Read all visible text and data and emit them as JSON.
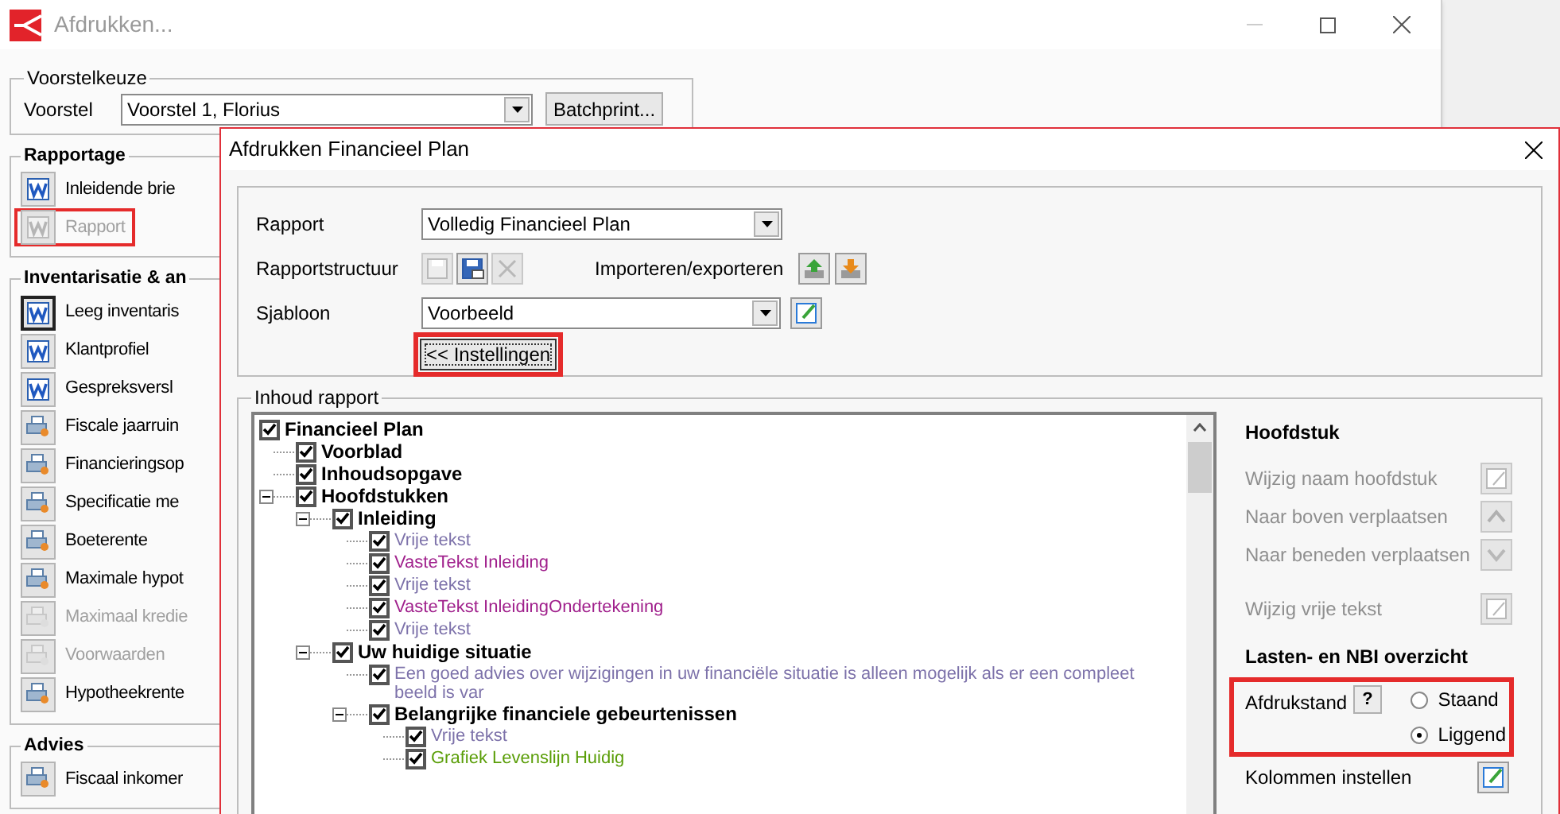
{
  "back_window": {
    "title": "Afdrukken...",
    "voorstelkeuze": {
      "title": "Voorstelkeuze",
      "label": "Voorstel",
      "value": "Voorstel 1, Florius",
      "button": "Batchprint..."
    },
    "groups": [
      {
        "title": "Rapportage",
        "items": [
          {
            "label": "Inleidende brie",
            "kind": "word",
            "disabled": false,
            "focused": false,
            "highlighted": false
          },
          {
            "label": "Rapport",
            "kind": "word",
            "disabled": true,
            "focused": false,
            "highlighted": true
          }
        ]
      },
      {
        "title": "Inventarisatie & an",
        "items": [
          {
            "label": "Leeg inventaris",
            "kind": "word",
            "disabled": false,
            "focused": true,
            "highlighted": false
          },
          {
            "label": "Klantprofiel",
            "kind": "word",
            "disabled": false,
            "focused": false,
            "highlighted": false
          },
          {
            "label": "Gespreksversl",
            "kind": "word",
            "disabled": false,
            "focused": false,
            "highlighted": false
          },
          {
            "label": "Fiscale jaarruin",
            "kind": "report",
            "disabled": false,
            "focused": false,
            "highlighted": false
          },
          {
            "label": "Financieringsop",
            "kind": "report",
            "disabled": false,
            "focused": false,
            "highlighted": false
          },
          {
            "label": "Specificatie me",
            "kind": "report",
            "disabled": false,
            "focused": false,
            "highlighted": false
          },
          {
            "label": "Boeterente",
            "kind": "report",
            "disabled": false,
            "focused": false,
            "highlighted": false
          },
          {
            "label": "Maximale hypot",
            "kind": "report",
            "disabled": false,
            "focused": false,
            "highlighted": false
          },
          {
            "label": "Maximaal kredie",
            "kind": "report",
            "disabled": true,
            "focused": false,
            "highlighted": false
          },
          {
            "label": "Voorwaarden",
            "kind": "report",
            "disabled": true,
            "focused": false,
            "highlighted": false
          },
          {
            "label": "Hypotheekrente",
            "kind": "report",
            "disabled": false,
            "focused": false,
            "highlighted": false
          }
        ]
      },
      {
        "title": "Advies",
        "items": [
          {
            "label": "Fiscaal inkomer",
            "kind": "report",
            "disabled": false,
            "focused": false,
            "highlighted": false
          }
        ]
      }
    ]
  },
  "dialog": {
    "title": "Afdrukken Financieel Plan",
    "rapport": {
      "label": "Rapport",
      "value": "Volledig Financieel Plan"
    },
    "structuur": {
      "label": "Rapportstructuur",
      "icons": [
        {
          "kind": "save",
          "disabled": true
        },
        {
          "kind": "save-as",
          "disabled": false
        },
        {
          "kind": "delete",
          "disabled": true
        }
      ]
    },
    "import_export": {
      "label": "Importeren/exporteren",
      "icons": [
        {
          "kind": "import"
        },
        {
          "kind": "export"
        }
      ]
    },
    "sjabloon": {
      "label": "Sjabloon",
      "value": "Voorbeeld"
    },
    "settings_button": {
      "label": "<< Instellingen",
      "highlighted": true
    },
    "content": {
      "title": "Inhoud rapport",
      "tree": [
        {
          "label": "Financieel Plan",
          "kind": "heading",
          "checked": true,
          "children": [
            {
              "label": "Voorblad",
              "kind": "heading",
              "checked": true
            },
            {
              "label": "Inhoudsopgave",
              "kind": "heading",
              "checked": true
            },
            {
              "label": "Hoofdstukken",
              "kind": "heading",
              "checked": true,
              "expanded": true,
              "children": [
                {
                  "label": "Inleiding",
                  "kind": "heading",
                  "checked": true,
                  "expanded": true,
                  "children": [
                    {
                      "label": "Vrije tekst",
                      "kind": "text",
                      "checked": true,
                      "color": "#7d72aa"
                    },
                    {
                      "label": "VasteTekst Inleiding",
                      "kind": "text",
                      "checked": true,
                      "color": "#a0208c"
                    },
                    {
                      "label": "Vrije tekst",
                      "kind": "text",
                      "checked": true,
                      "color": "#7d72aa"
                    },
                    {
                      "label": "VasteTekst InleidingOndertekening",
                      "kind": "text",
                      "checked": true,
                      "color": "#a0208c"
                    },
                    {
                      "label": "Vrije tekst",
                      "kind": "text",
                      "checked": true,
                      "color": "#7d72aa"
                    }
                  ]
                },
                {
                  "label": "Uw huidige situatie",
                  "kind": "heading",
                  "checked": true,
                  "expanded": true,
                  "children": [
                    {
                      "label": "Een goed advies over wijzigingen in uw financiële situatie is alleen mogelijk als er een compleet beeld is var",
                      "kind": "text",
                      "checked": true,
                      "color": "#7d72aa"
                    },
                    {
                      "label": "Belangrijke financiele gebeurtenissen",
                      "kind": "heading",
                      "checked": true,
                      "expanded": true,
                      "children": [
                        {
                          "label": "Vrije tekst",
                          "kind": "text",
                          "checked": true,
                          "color": "#7d72aa"
                        },
                        {
                          "label": "Grafiek Levenslijn Huidig",
                          "kind": "text",
                          "checked": true,
                          "color": "#5a9e08"
                        }
                      ]
                    }
                  ]
                }
              ]
            }
          ]
        }
      ]
    },
    "side": {
      "section_title": "Hoofdstuk",
      "actions": [
        {
          "label": "Wijzig naam hoofdstuk",
          "kind": "edit",
          "disabled": true
        },
        {
          "label": "Naar boven verplaatsen",
          "kind": "up",
          "disabled": true
        },
        {
          "label": "Naar beneden verplaatsen",
          "kind": "down",
          "disabled": true
        },
        {
          "label": "Wijzig vrije tekst",
          "kind": "edit",
          "disabled": true
        }
      ],
      "overview_title": "Lasten- en NBI overzicht",
      "orientation": {
        "label": "Afdrukstand",
        "help": "?",
        "highlighted": true,
        "options": [
          {
            "label": "Staand",
            "selected": false
          },
          {
            "label": "Liggend",
            "selected": true
          }
        ]
      },
      "columns": {
        "label": "Kolommen instellen"
      }
    }
  }
}
